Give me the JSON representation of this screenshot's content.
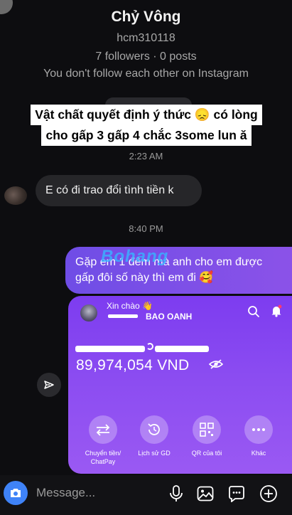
{
  "profile": {
    "name": "Chỷ Vông",
    "handle": "hcm310118",
    "stats": "7 followers · 0 posts",
    "relationship": "You don't follow each other on Instagram"
  },
  "banner_text": {
    "line1": "Vật chất quyết định ý thức 😞 có lòng",
    "line2": "cho gấp 3 gấp 4 chắc 3some lun ă"
  },
  "messages": [
    {
      "time": "2:23 AM",
      "text": "E có đi trao đổi tình tiền k",
      "direction": "received"
    },
    {
      "time": "8:40 PM",
      "text": "Gặp em 1 đêm mà anh cho em được gấp đôi số này thì em đi 🥰",
      "direction": "sent"
    }
  ],
  "watermark": "Bohang",
  "payment_card": {
    "greeting": "Xin chào 👋",
    "account_name": "BAO OANH",
    "balance": "89,974,054 VND",
    "actions": [
      {
        "label": "Chuyển tiền/ ChatPay",
        "icon": "transfer-icon"
      },
      {
        "label": "Lịch sử GD",
        "icon": "history-icon"
      },
      {
        "label": "QR của tôi",
        "icon": "qr-icon"
      },
      {
        "label": "Khác",
        "icon": "more-icon"
      }
    ],
    "colors": {
      "top": "#7d3cf0",
      "bottom": "#9a59f3"
    }
  },
  "composer": {
    "placeholder": "Message...",
    "icons": [
      "camera-icon",
      "microphone-icon",
      "gallery-icon",
      "sticker-icon",
      "add-icon"
    ]
  },
  "colors": {
    "accent_blue": "#3f83f8",
    "sent_bubble": "#7a50e7",
    "background": "#0d0d10"
  }
}
